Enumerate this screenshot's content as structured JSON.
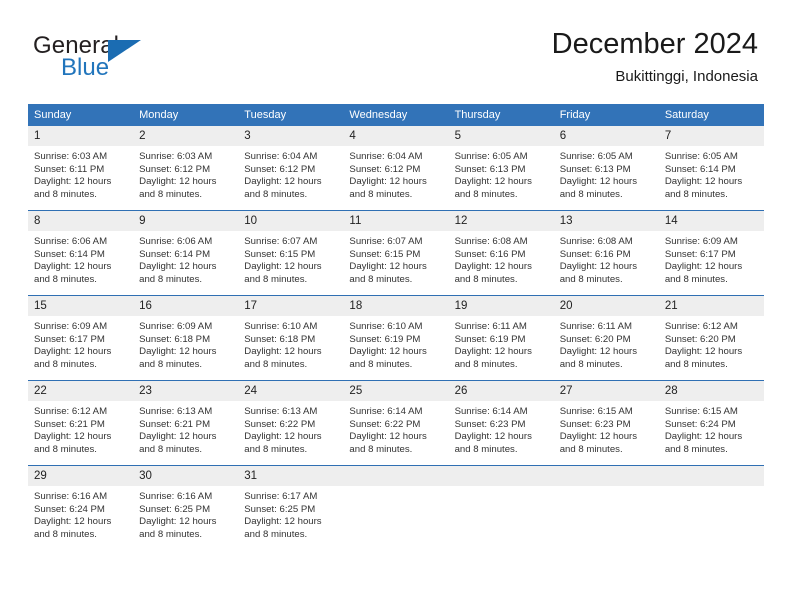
{
  "brand": {
    "name_part1": "General",
    "name_part2": "Blue"
  },
  "header": {
    "title": "December 2024",
    "subtitle": "Bukittinggi, Indonesia"
  },
  "colors": {
    "header_blue": "#3273b8",
    "row_divider_blue": "#2f6fb3",
    "daynum_band": "#eeeeee",
    "brand_blue": "#2175bc",
    "text": "#222222"
  },
  "weekday_headers": [
    "Sunday",
    "Monday",
    "Tuesday",
    "Wednesday",
    "Thursday",
    "Friday",
    "Saturday"
  ],
  "weeks": [
    [
      {
        "day": "1",
        "sunrise": "Sunrise: 6:03 AM",
        "sunset": "Sunset: 6:11 PM",
        "daylight_line1": "Daylight: 12 hours",
        "daylight_line2": "and 8 minutes."
      },
      {
        "day": "2",
        "sunrise": "Sunrise: 6:03 AM",
        "sunset": "Sunset: 6:12 PM",
        "daylight_line1": "Daylight: 12 hours",
        "daylight_line2": "and 8 minutes."
      },
      {
        "day": "3",
        "sunrise": "Sunrise: 6:04 AM",
        "sunset": "Sunset: 6:12 PM",
        "daylight_line1": "Daylight: 12 hours",
        "daylight_line2": "and 8 minutes."
      },
      {
        "day": "4",
        "sunrise": "Sunrise: 6:04 AM",
        "sunset": "Sunset: 6:12 PM",
        "daylight_line1": "Daylight: 12 hours",
        "daylight_line2": "and 8 minutes."
      },
      {
        "day": "5",
        "sunrise": "Sunrise: 6:05 AM",
        "sunset": "Sunset: 6:13 PM",
        "daylight_line1": "Daylight: 12 hours",
        "daylight_line2": "and 8 minutes."
      },
      {
        "day": "6",
        "sunrise": "Sunrise: 6:05 AM",
        "sunset": "Sunset: 6:13 PM",
        "daylight_line1": "Daylight: 12 hours",
        "daylight_line2": "and 8 minutes."
      },
      {
        "day": "7",
        "sunrise": "Sunrise: 6:05 AM",
        "sunset": "Sunset: 6:14 PM",
        "daylight_line1": "Daylight: 12 hours",
        "daylight_line2": "and 8 minutes."
      }
    ],
    [
      {
        "day": "8",
        "sunrise": "Sunrise: 6:06 AM",
        "sunset": "Sunset: 6:14 PM",
        "daylight_line1": "Daylight: 12 hours",
        "daylight_line2": "and 8 minutes."
      },
      {
        "day": "9",
        "sunrise": "Sunrise: 6:06 AM",
        "sunset": "Sunset: 6:14 PM",
        "daylight_line1": "Daylight: 12 hours",
        "daylight_line2": "and 8 minutes."
      },
      {
        "day": "10",
        "sunrise": "Sunrise: 6:07 AM",
        "sunset": "Sunset: 6:15 PM",
        "daylight_line1": "Daylight: 12 hours",
        "daylight_line2": "and 8 minutes."
      },
      {
        "day": "11",
        "sunrise": "Sunrise: 6:07 AM",
        "sunset": "Sunset: 6:15 PM",
        "daylight_line1": "Daylight: 12 hours",
        "daylight_line2": "and 8 minutes."
      },
      {
        "day": "12",
        "sunrise": "Sunrise: 6:08 AM",
        "sunset": "Sunset: 6:16 PM",
        "daylight_line1": "Daylight: 12 hours",
        "daylight_line2": "and 8 minutes."
      },
      {
        "day": "13",
        "sunrise": "Sunrise: 6:08 AM",
        "sunset": "Sunset: 6:16 PM",
        "daylight_line1": "Daylight: 12 hours",
        "daylight_line2": "and 8 minutes."
      },
      {
        "day": "14",
        "sunrise": "Sunrise: 6:09 AM",
        "sunset": "Sunset: 6:17 PM",
        "daylight_line1": "Daylight: 12 hours",
        "daylight_line2": "and 8 minutes."
      }
    ],
    [
      {
        "day": "15",
        "sunrise": "Sunrise: 6:09 AM",
        "sunset": "Sunset: 6:17 PM",
        "daylight_line1": "Daylight: 12 hours",
        "daylight_line2": "and 8 minutes."
      },
      {
        "day": "16",
        "sunrise": "Sunrise: 6:09 AM",
        "sunset": "Sunset: 6:18 PM",
        "daylight_line1": "Daylight: 12 hours",
        "daylight_line2": "and 8 minutes."
      },
      {
        "day": "17",
        "sunrise": "Sunrise: 6:10 AM",
        "sunset": "Sunset: 6:18 PM",
        "daylight_line1": "Daylight: 12 hours",
        "daylight_line2": "and 8 minutes."
      },
      {
        "day": "18",
        "sunrise": "Sunrise: 6:10 AM",
        "sunset": "Sunset: 6:19 PM",
        "daylight_line1": "Daylight: 12 hours",
        "daylight_line2": "and 8 minutes."
      },
      {
        "day": "19",
        "sunrise": "Sunrise: 6:11 AM",
        "sunset": "Sunset: 6:19 PM",
        "daylight_line1": "Daylight: 12 hours",
        "daylight_line2": "and 8 minutes."
      },
      {
        "day": "20",
        "sunrise": "Sunrise: 6:11 AM",
        "sunset": "Sunset: 6:20 PM",
        "daylight_line1": "Daylight: 12 hours",
        "daylight_line2": "and 8 minutes."
      },
      {
        "day": "21",
        "sunrise": "Sunrise: 6:12 AM",
        "sunset": "Sunset: 6:20 PM",
        "daylight_line1": "Daylight: 12 hours",
        "daylight_line2": "and 8 minutes."
      }
    ],
    [
      {
        "day": "22",
        "sunrise": "Sunrise: 6:12 AM",
        "sunset": "Sunset: 6:21 PM",
        "daylight_line1": "Daylight: 12 hours",
        "daylight_line2": "and 8 minutes."
      },
      {
        "day": "23",
        "sunrise": "Sunrise: 6:13 AM",
        "sunset": "Sunset: 6:21 PM",
        "daylight_line1": "Daylight: 12 hours",
        "daylight_line2": "and 8 minutes."
      },
      {
        "day": "24",
        "sunrise": "Sunrise: 6:13 AM",
        "sunset": "Sunset: 6:22 PM",
        "daylight_line1": "Daylight: 12 hours",
        "daylight_line2": "and 8 minutes."
      },
      {
        "day": "25",
        "sunrise": "Sunrise: 6:14 AM",
        "sunset": "Sunset: 6:22 PM",
        "daylight_line1": "Daylight: 12 hours",
        "daylight_line2": "and 8 minutes."
      },
      {
        "day": "26",
        "sunrise": "Sunrise: 6:14 AM",
        "sunset": "Sunset: 6:23 PM",
        "daylight_line1": "Daylight: 12 hours",
        "daylight_line2": "and 8 minutes."
      },
      {
        "day": "27",
        "sunrise": "Sunrise: 6:15 AM",
        "sunset": "Sunset: 6:23 PM",
        "daylight_line1": "Daylight: 12 hours",
        "daylight_line2": "and 8 minutes."
      },
      {
        "day": "28",
        "sunrise": "Sunrise: 6:15 AM",
        "sunset": "Sunset: 6:24 PM",
        "daylight_line1": "Daylight: 12 hours",
        "daylight_line2": "and 8 minutes."
      }
    ],
    [
      {
        "day": "29",
        "sunrise": "Sunrise: 6:16 AM",
        "sunset": "Sunset: 6:24 PM",
        "daylight_line1": "Daylight: 12 hours",
        "daylight_line2": "and 8 minutes."
      },
      {
        "day": "30",
        "sunrise": "Sunrise: 6:16 AM",
        "sunset": "Sunset: 6:25 PM",
        "daylight_line1": "Daylight: 12 hours",
        "daylight_line2": "and 8 minutes."
      },
      {
        "day": "31",
        "sunrise": "Sunrise: 6:17 AM",
        "sunset": "Sunset: 6:25 PM",
        "daylight_line1": "Daylight: 12 hours",
        "daylight_line2": "and 8 minutes."
      },
      {
        "day": "",
        "sunrise": "",
        "sunset": "",
        "daylight_line1": "",
        "daylight_line2": ""
      },
      {
        "day": "",
        "sunrise": "",
        "sunset": "",
        "daylight_line1": "",
        "daylight_line2": ""
      },
      {
        "day": "",
        "sunrise": "",
        "sunset": "",
        "daylight_line1": "",
        "daylight_line2": ""
      },
      {
        "day": "",
        "sunrise": "",
        "sunset": "",
        "daylight_line1": "",
        "daylight_line2": ""
      }
    ]
  ]
}
